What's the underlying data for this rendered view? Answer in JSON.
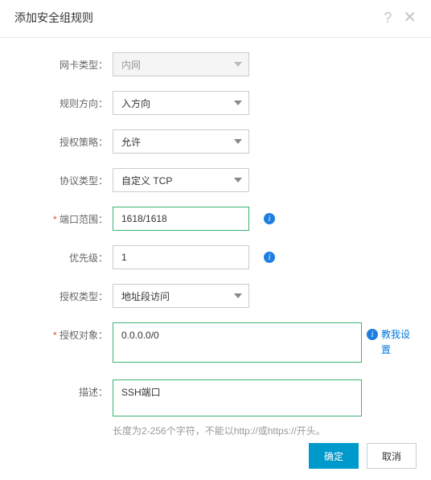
{
  "dialog": {
    "title": "添加安全组规则",
    "help_icon": "?",
    "close_icon": "✕"
  },
  "form": {
    "nic_type": {
      "label": "网卡类型：",
      "value": "内网"
    },
    "direction": {
      "label": "规则方向：",
      "value": "入方向"
    },
    "policy": {
      "label": "授权策略：",
      "value": "允许"
    },
    "protocol": {
      "label": "协议类型：",
      "value": "自定义 TCP"
    },
    "port_range": {
      "label": "端口范围：",
      "value": "1618/1618"
    },
    "priority": {
      "label": "优先级：",
      "value": "1"
    },
    "auth_type": {
      "label": "授权类型：",
      "value": "地址段访问"
    },
    "auth_obj": {
      "label": "授权对象：",
      "value": "0.0.0.0/0",
      "help_link": "教我设置"
    },
    "desc": {
      "label": "描述：",
      "value": "SSH端口",
      "hint": "长度为2-256个字符，不能以http://或https://开头。"
    }
  },
  "footer": {
    "ok": "确定",
    "cancel": "取消"
  }
}
